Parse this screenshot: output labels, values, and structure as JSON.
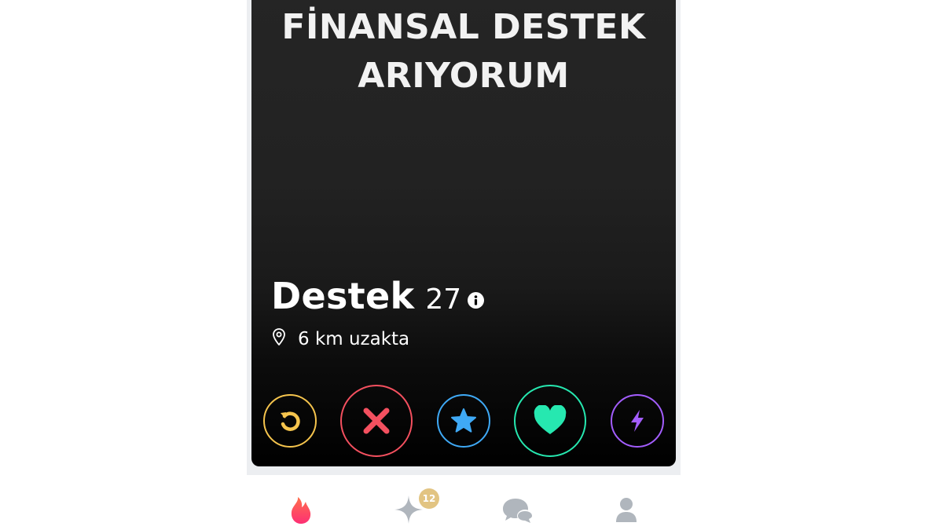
{
  "card": {
    "headline_line1": "FİNANSAL DESTEK",
    "headline_line2": "ARIYORUM",
    "profile_name": "Destek",
    "profile_age": "27",
    "distance": "6 km uzakta"
  },
  "actions": [
    {
      "name": "rewind",
      "icon": "rewind-icon",
      "color": "#f5c44d"
    },
    {
      "name": "nope",
      "icon": "close-icon",
      "color": "#f4505f"
    },
    {
      "name": "super-like",
      "icon": "star-icon",
      "color": "#3fa9f5"
    },
    {
      "name": "like",
      "icon": "heart-icon",
      "color": "#26e8b0"
    },
    {
      "name": "boost",
      "icon": "lightning-icon",
      "color": "#a35dfd"
    }
  ],
  "tabbar": {
    "items": [
      {
        "name": "discover",
        "icon": "flame-icon",
        "color": "#fd4a6b"
      },
      {
        "name": "likes",
        "icon": "sparkle-icon",
        "color": "#b0b6bd"
      },
      {
        "name": "messages",
        "icon": "chat-icon",
        "color": "#b0b6bd"
      },
      {
        "name": "profile",
        "icon": "user-icon",
        "color": "#b0b6bd"
      }
    ],
    "likes_badge_count": "12"
  }
}
